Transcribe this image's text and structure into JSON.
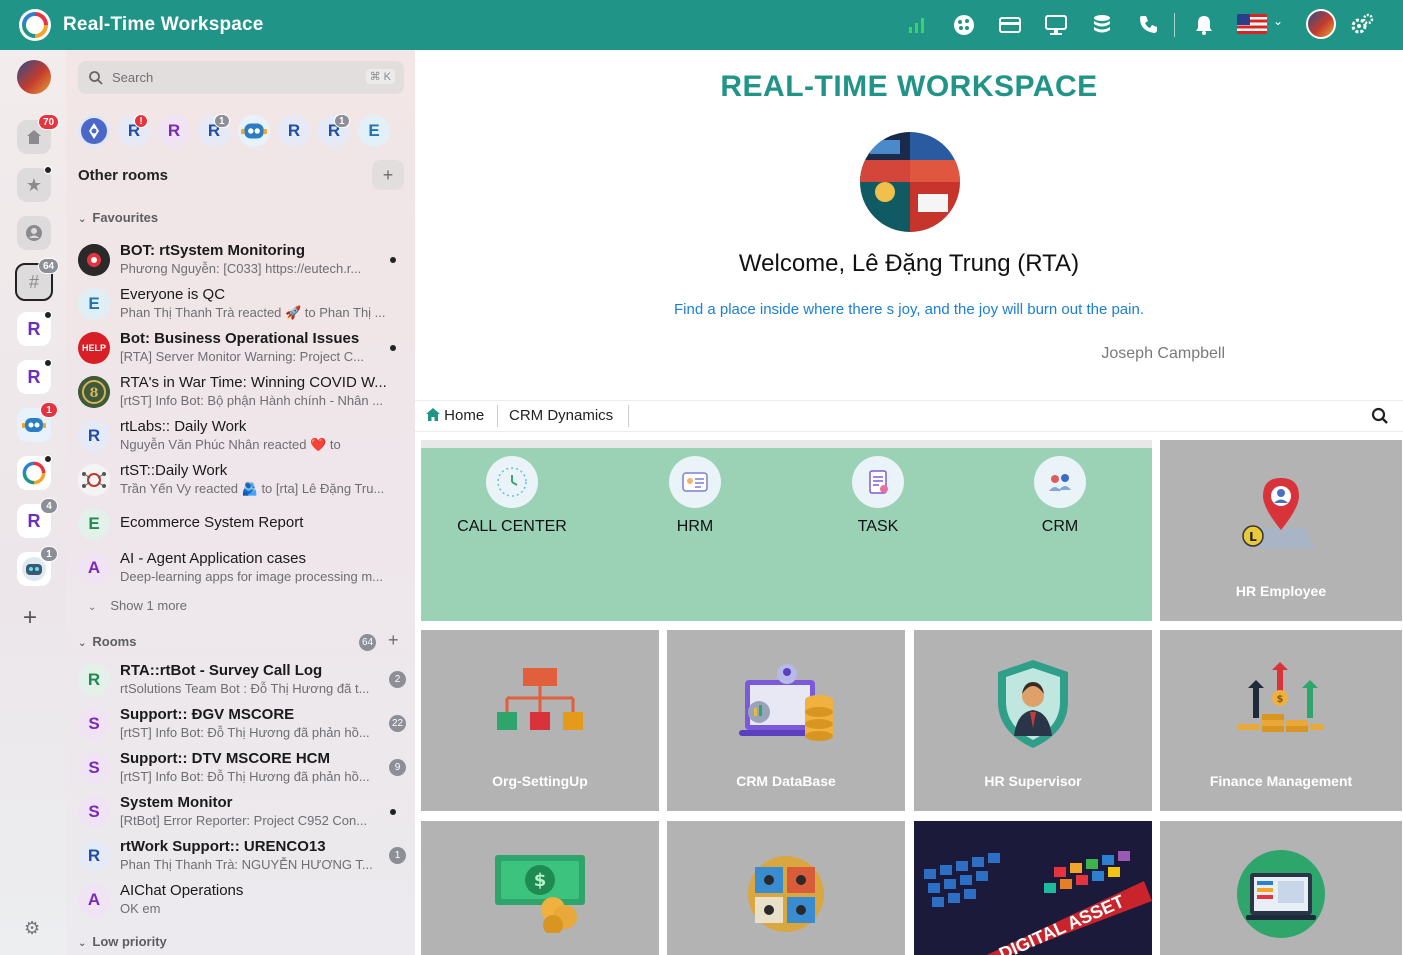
{
  "app": {
    "title": "Real-Time Workspace"
  },
  "topbar": {
    "icons": [
      "signal-bars-icon",
      "palette-icon",
      "card-icon",
      "monitor-icon",
      "database-icon",
      "phone-icon",
      "bell-icon",
      "language-flag-icon",
      "user-avatar",
      "settings-gears-icon"
    ]
  },
  "rail": {
    "home_badge": "70",
    "rooms_badge": "64",
    "bot_badge": "1",
    "space_r3_badge": "4",
    "assistant_badge": "1",
    "letter": "R"
  },
  "search": {
    "placeholder": "Search",
    "shortcut": "⌘ K"
  },
  "recent_rooms": [
    {
      "letter": "",
      "color": "#4a67c9",
      "badge": ""
    },
    {
      "letter": "R",
      "color": "#1d4fa8",
      "badge": "!"
    },
    {
      "letter": "R",
      "color": "#7a2ab8",
      "badge": ""
    },
    {
      "letter": "R",
      "color": "#1d4fa8",
      "badge": "1"
    },
    {
      "letter": "",
      "color": "#2b7ec4",
      "badge": ""
    },
    {
      "letter": "R",
      "color": "#1d4fa8",
      "badge": ""
    },
    {
      "letter": "R",
      "color": "#1d4fa8",
      "badge": "1"
    },
    {
      "letter": "E",
      "color": "#1f74b5",
      "badge": ""
    }
  ],
  "other_rooms_label": "Other rooms",
  "favourites": {
    "label": "Favourites",
    "show_more": "Show 1 more",
    "items": [
      {
        "name": "BOT: rtSystem Monitoring",
        "msg": "Phương Nguyễn: [C033] https://eutech.r...",
        "bold": true,
        "dot": true
      },
      {
        "name": "Everyone is QC",
        "msg": "Phan Thị Thanh Trà reacted 🚀 to Phan Thị ...",
        "bold": false,
        "dot": false,
        "letter": "E"
      },
      {
        "name": "Bot: Business Operational Issues",
        "msg": "[RTA] Server Monitor Warning: Project C...",
        "bold": true,
        "dot": true
      },
      {
        "name": "RTA's in War Time: Winning COVID W...",
        "msg": "[rtST] Info Bot: Bộ phận Hành chính - Nhân ...",
        "bold": false,
        "dot": false
      },
      {
        "name": "rtLabs:: Daily Work",
        "msg": "Nguyễn Văn Phúc Nhân reacted ❤️ to",
        "bold": false,
        "dot": false,
        "letter": "R"
      },
      {
        "name": "rtST::Daily Work",
        "msg": "Trần Yến Vy reacted 🫂 to [rta] Lê Đặng Tru...",
        "bold": false,
        "dot": false
      },
      {
        "name": "Ecommerce System Report",
        "msg": "",
        "bold": false,
        "dot": false,
        "letter": "E"
      },
      {
        "name": "AI - Agent Application cases",
        "msg": "Deep-learning apps for image processing m...",
        "bold": false,
        "dot": false,
        "letter": "A"
      }
    ]
  },
  "rooms": {
    "label": "Rooms",
    "count": "64",
    "items": [
      {
        "name": "RTA::rtBot - Survey Call Log",
        "msg": "rtSolutions Team Bot : Đỗ Thị Hương đã t...",
        "letter": "R",
        "count": "2"
      },
      {
        "name": "Support:: ĐGV MSCORE",
        "msg": "[rtST] Info Bot: Đỗ Thị Hương đã phản hồ...",
        "letter": "S",
        "count": "22"
      },
      {
        "name": "Support:: DTV MSCORE HCM",
        "msg": "[rtST] Info Bot: Đỗ Thị Hương đã phản hồ...",
        "letter": "S",
        "count": "9"
      },
      {
        "name": "System Monitor",
        "msg": "[RtBot] Error Reporter: Project C952 Con...",
        "letter": "S",
        "count": ""
      },
      {
        "name": "rtWork Support:: URENCO13",
        "msg": "Phan Thị Thanh Trà: NGUYỄN HƯƠNG T...",
        "letter": "R",
        "count": "1"
      },
      {
        "name": "AIChat Operations",
        "msg": "OK em",
        "letter": "A",
        "count": ""
      }
    ]
  },
  "low_priority_label": "Low priority",
  "main": {
    "heading": "REAL-TIME WORKSPACE",
    "welcome": "Welcome, Lê Đặng Trung (RTA)",
    "quote": "Find a place inside where there s joy, and the joy will burn out the pain.",
    "author": "Joseph Campbell",
    "tabs": [
      "Home",
      "CRM Dynamics"
    ],
    "apps": [
      "CALL CENTER",
      "HRM",
      "TASK",
      "CRM"
    ],
    "tiles": [
      "HR Employee",
      "Org-SettingUp",
      "CRM DataBase",
      "HR Supervisor",
      "Finance Management"
    ],
    "banner_text": "DIGITAL ASSET"
  },
  "colors": {
    "accent": "#1f9487",
    "quote": "#1a7fd4",
    "green_panel": "#9bd2b6",
    "tile_grey": "#b3b3b3"
  }
}
